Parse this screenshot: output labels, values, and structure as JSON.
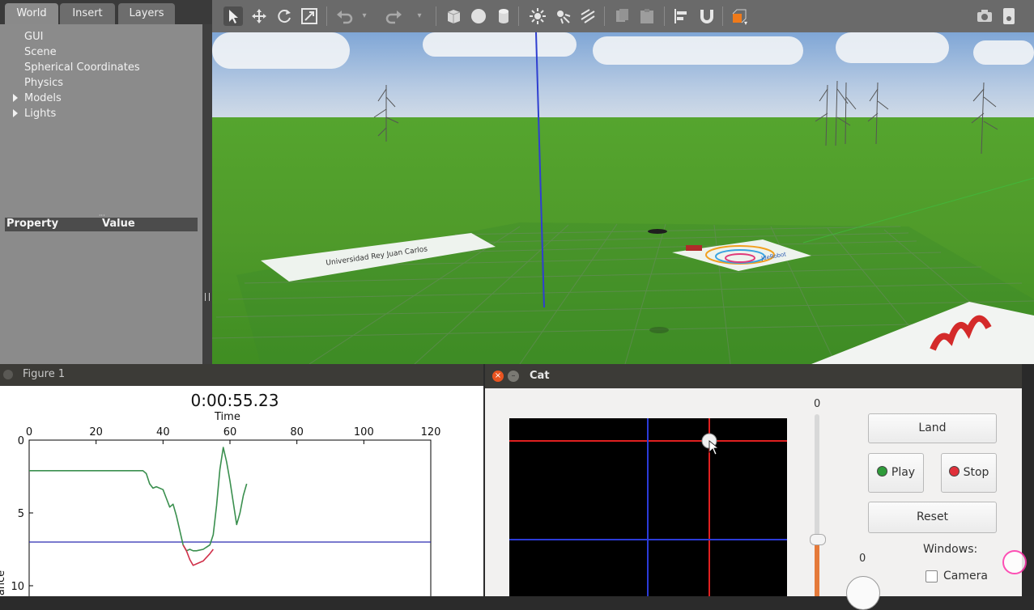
{
  "gazebo": {
    "tabs": [
      "World",
      "Insert",
      "Layers"
    ],
    "world_tree": [
      {
        "label": "GUI",
        "expandable": false
      },
      {
        "label": "Scene",
        "expandable": false
      },
      {
        "label": "Spherical Coordinates",
        "expandable": false
      },
      {
        "label": "Physics",
        "expandable": false
      },
      {
        "label": "Models",
        "expandable": true
      },
      {
        "label": "Lights",
        "expandable": true
      }
    ],
    "property_header": {
      "property": "Property",
      "value": "Value"
    },
    "toolbar_icons": [
      "select-arrow-icon",
      "translate-icon",
      "rotate-icon",
      "scale-icon",
      "undo-icon",
      "undo-dropdown-icon",
      "redo-icon",
      "redo-dropdown-icon",
      "box-icon",
      "sphere-icon",
      "cylinder-icon",
      "point-light-icon",
      "spot-light-icon",
      "directional-light-icon",
      "copy-icon",
      "paste-icon",
      "align-icon",
      "snap-icon",
      "view-angle-icon",
      "screenshot-icon",
      "log-icon"
    ],
    "sign_left_text": "Universidad Rey Juan Carlos",
    "sign_right_text": "JdeRobot"
  },
  "figure": {
    "window_title": "Figure 1",
    "timer": "0:00:55.23",
    "xlabel": "Time",
    "ylabel_partial": "ance"
  },
  "chart_data": {
    "type": "line",
    "title": "0:00:55.23",
    "xlabel": "Time",
    "ylabel": "ance",
    "xlim": [
      0,
      120
    ],
    "ylim": [
      10,
      0
    ],
    "xticks": [
      0,
      20,
      40,
      60,
      80,
      100,
      120
    ],
    "yticks": [
      0,
      5,
      10
    ],
    "reference_line": {
      "y": 7,
      "color": "#2b2bb0"
    },
    "series": [
      {
        "color": "#3a8f4e",
        "x": [
          0,
          34,
          35,
          36,
          37,
          38,
          40,
          41,
          42,
          43,
          44,
          45,
          46,
          47,
          48,
          49,
          50,
          52,
          54,
          55,
          56,
          57,
          58,
          59,
          60,
          61,
          62,
          63,
          64,
          65
        ],
        "y": [
          2.1,
          2.1,
          2.3,
          3.0,
          3.3,
          3.2,
          3.4,
          4.0,
          4.6,
          4.4,
          5.2,
          6.2,
          7.2,
          7.6,
          7.5,
          7.6,
          7.6,
          7.5,
          7.2,
          6.5,
          4.5,
          2.0,
          0.5,
          1.5,
          2.8,
          4.3,
          5.8,
          5.0,
          3.8,
          3.0
        ]
      },
      {
        "color": "#d0304a",
        "x": [
          46,
          47,
          48,
          49,
          50,
          52,
          54,
          55
        ],
        "y": [
          7.2,
          7.6,
          8.2,
          8.6,
          8.5,
          8.3,
          7.8,
          7.5
        ]
      }
    ]
  },
  "cat": {
    "window_title": "Cat",
    "close_glyph": "×",
    "min_glyph": "–",
    "buttons": {
      "land": "Land",
      "play": "Play",
      "stop": "Stop",
      "reset": "Reset"
    },
    "slider_value": "0",
    "knob_value": "0",
    "windows_label": "Windows:",
    "camera_label": "Camera",
    "colors": {
      "led_play": "#2e9b3a",
      "led_stop": "#e0303a",
      "crosshair_red": "#e02020",
      "crosshair_blue": "#2b3bd8"
    }
  }
}
